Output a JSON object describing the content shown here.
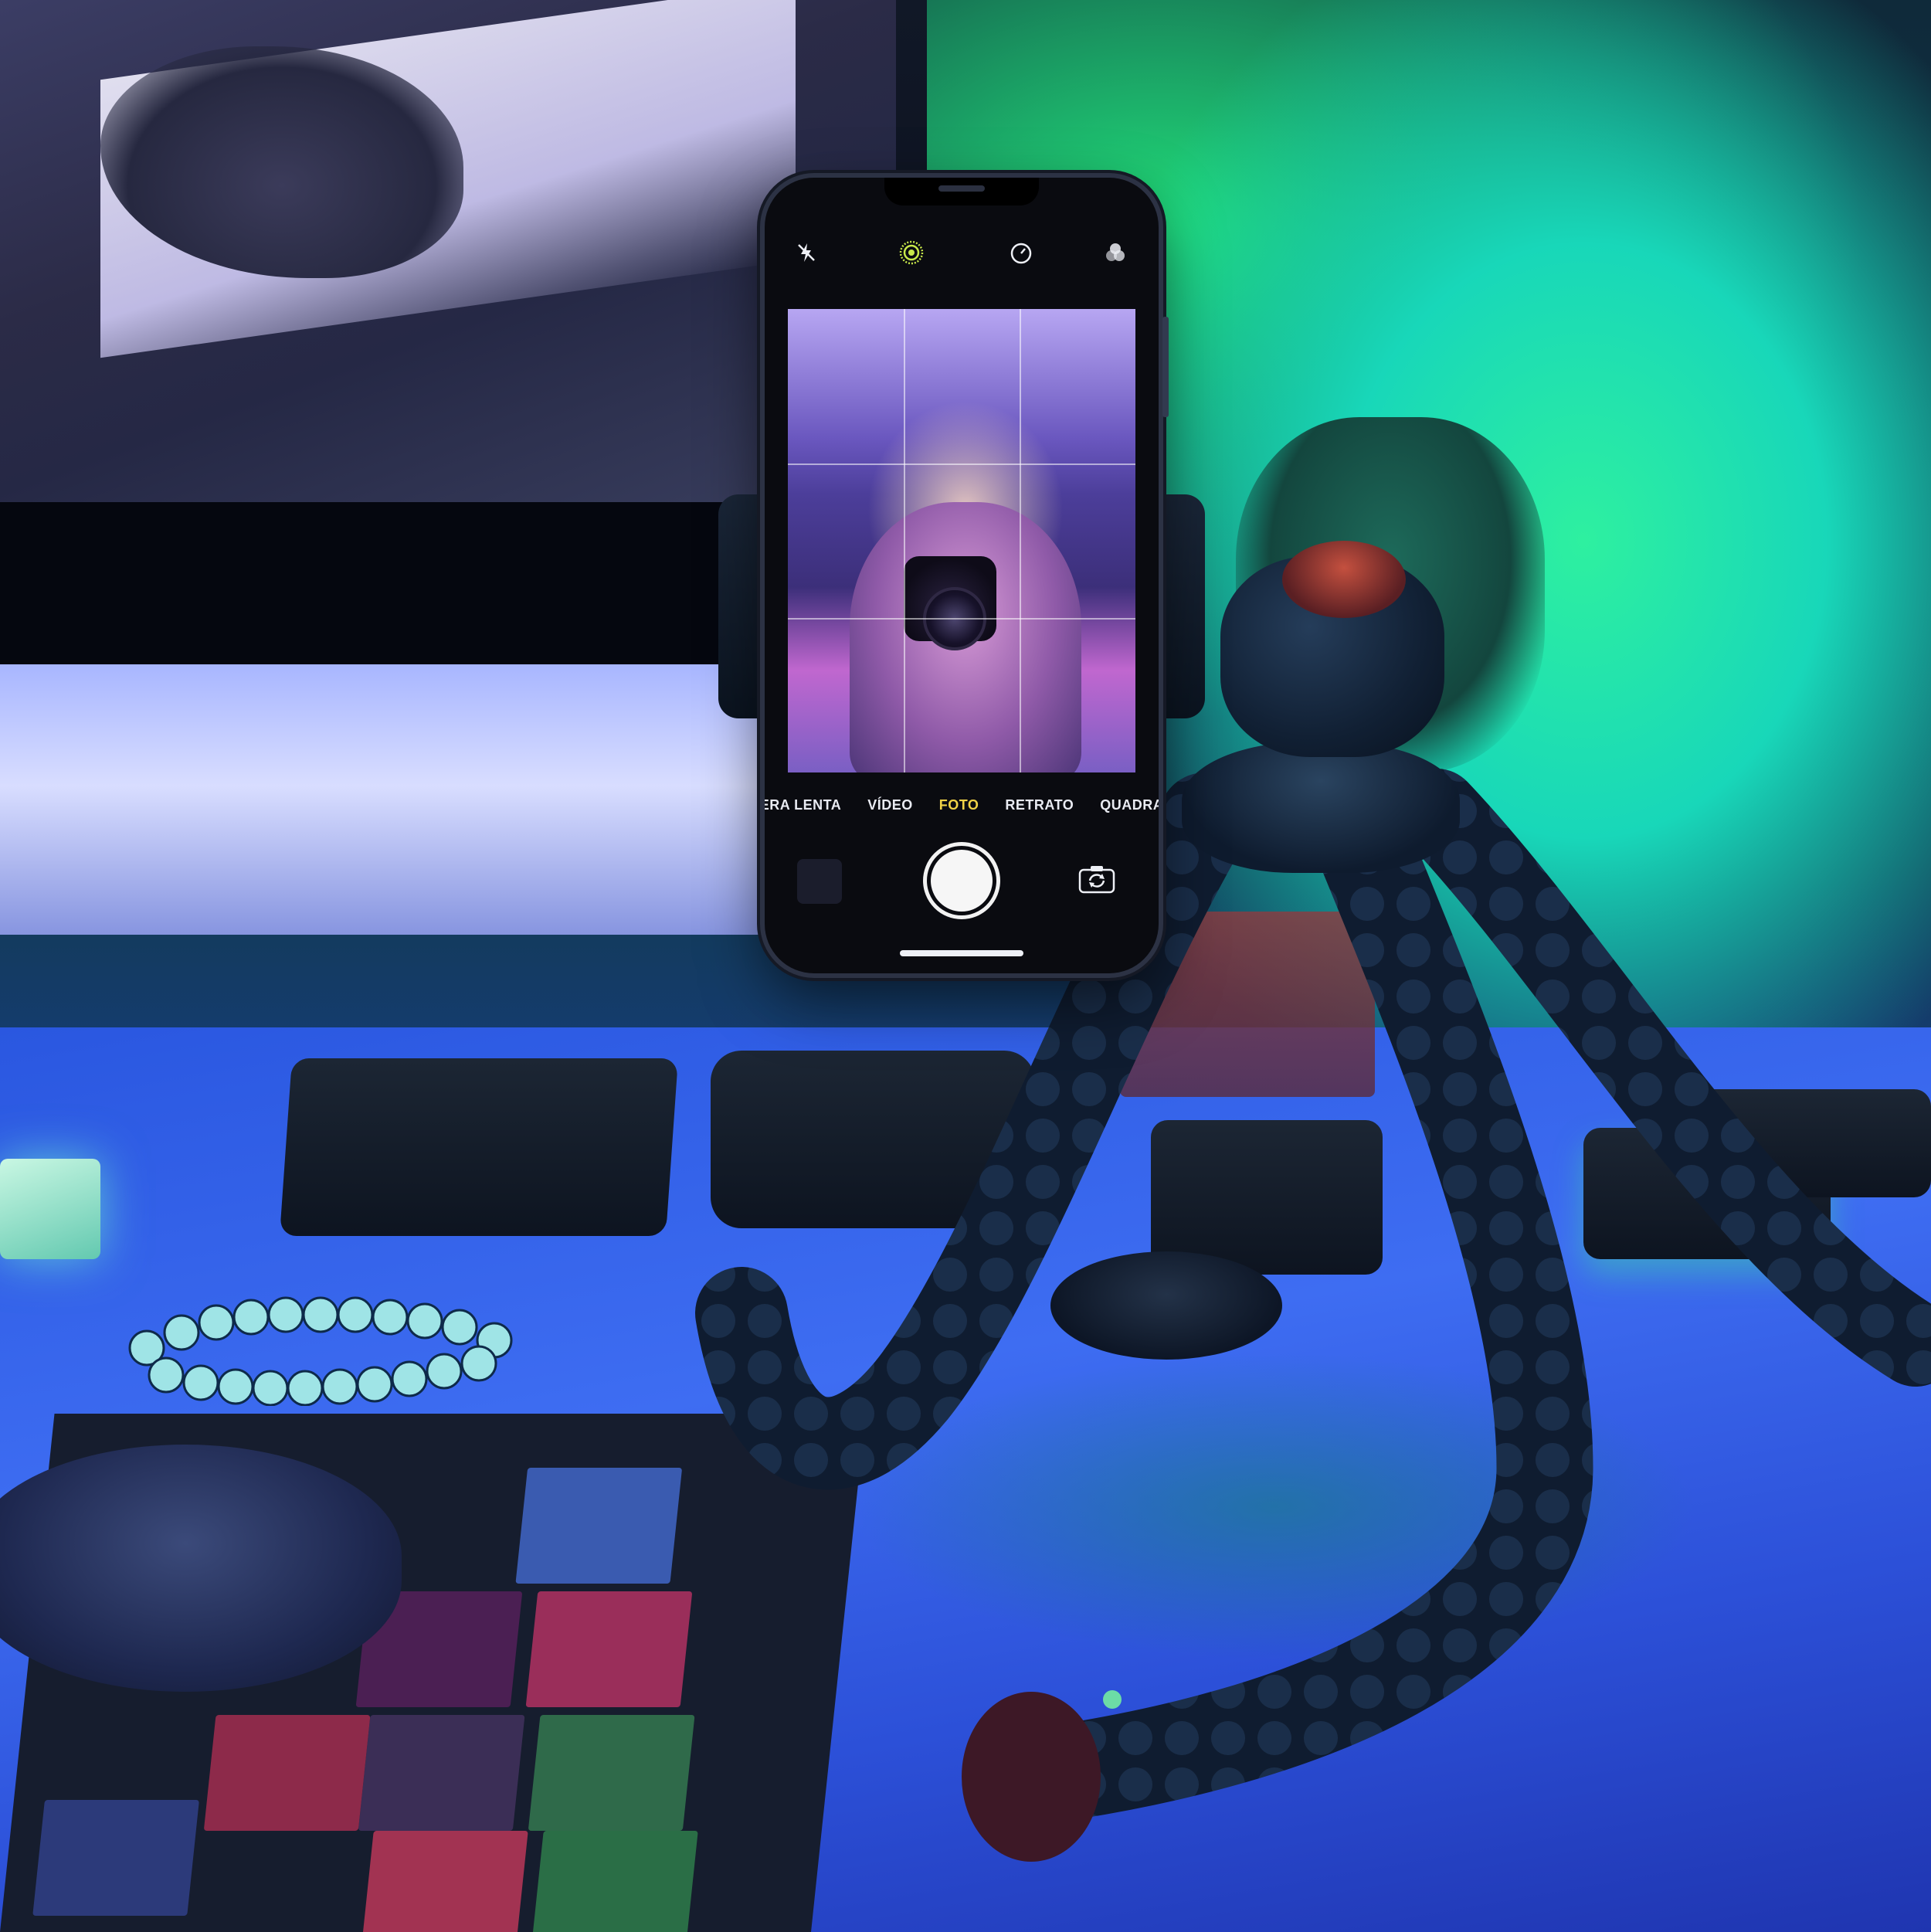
{
  "camera_app": {
    "top_icons": [
      "flash-off-icon",
      "live-photo-icon",
      "timer-icon",
      "filters-icon"
    ],
    "modes": [
      {
        "label": "ERA LENTA",
        "active": false
      },
      {
        "label": "VÍDEO",
        "active": false
      },
      {
        "label": "FOTO",
        "active": true
      },
      {
        "label": "RETRATO",
        "active": false
      },
      {
        "label": "QUADRA",
        "active": false
      }
    ],
    "controls": [
      "photo-thumbnail",
      "shutter-button",
      "camera-flip-icon"
    ]
  },
  "colors": {
    "accent_active_mode": "#f0d247",
    "live_photo_ring": "#c8e84a",
    "ambient_green": "#21e07a",
    "ambient_blue": "#2c50d8"
  }
}
